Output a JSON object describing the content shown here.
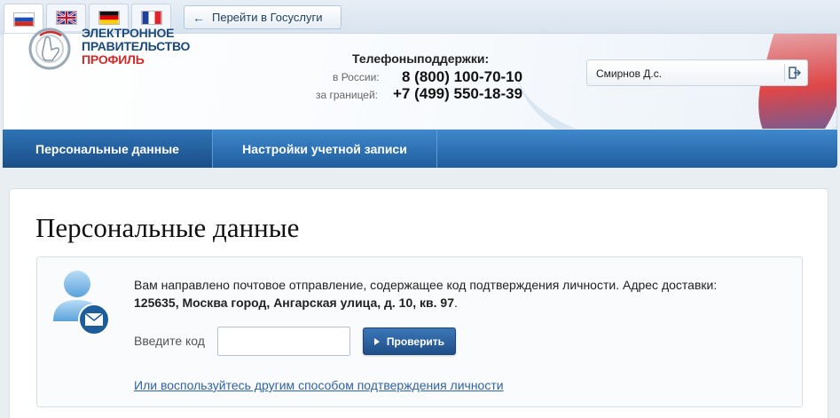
{
  "languages": [
    {
      "name": "ru-flag-icon",
      "active": true
    },
    {
      "name": "uk-flag-icon",
      "active": false
    },
    {
      "name": "de-flag-icon",
      "active": false
    },
    {
      "name": "fr-flag-icon",
      "active": false
    }
  ],
  "gosuslugi_button": "Перейти в Госуслуги",
  "logo": {
    "line1": "ЭЛЕКТРОННОЕ",
    "line2": "ПРАВИТЕЛЬСТВО",
    "line3": "ПРОФИЛЬ"
  },
  "support": {
    "title": "Телефоныподдержки:",
    "russia_label": "в России:",
    "russia_phone": "8 (800) 100-70-10",
    "abroad_label": "за границей:",
    "abroad_phone": "+7 (499) 550-18-39"
  },
  "user": {
    "name": "Смирнов Д.с."
  },
  "nav": {
    "tabs": [
      "Персональные данные",
      "Настройки учетной записи"
    ],
    "active_index": 0
  },
  "page": {
    "title": "Персональные данные",
    "message": "Вам направлено почтовое отправление, содержащее код подтверждения личности. Адрес доставки:",
    "address": "125635, Москва город, Ангарская улица, д. 10, кв. 97",
    "address_suffix": ".",
    "code_label": "Введите код",
    "code_value": "",
    "check_button": "Проверить",
    "alt_link": "Или воспользуйтесь другим способом подтверждения личности"
  },
  "colors": {
    "nav_blue": "#2a6fb3",
    "logo_blue": "#1c4a7a",
    "logo_red": "#d12b2b",
    "link": "#2f63a4"
  }
}
